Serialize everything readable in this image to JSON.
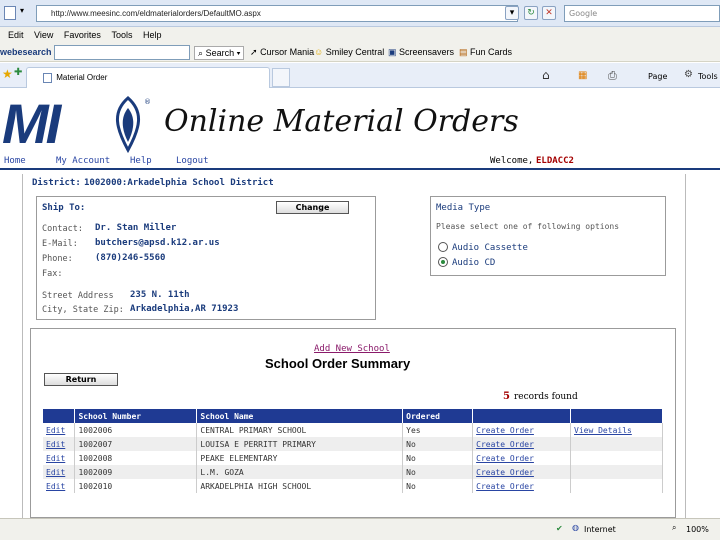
{
  "browser": {
    "url": "http://www.meesinc.com/eldmaterialorders/DefaultMO.aspx",
    "search_placeholder": "Google",
    "menu": [
      "Edit",
      "View",
      "Favorites",
      "Tools",
      "Help"
    ],
    "toolbar": {
      "brand": "webesearch",
      "search_label": "Search",
      "items": [
        "Cursor Mania",
        "Smiley Central",
        "Screensavers",
        "Fun Cards"
      ]
    },
    "tab_title": "Material Order",
    "tools_right": [
      "Page",
      "Tools"
    ],
    "status": {
      "zone": "Internet",
      "zoom": "100%"
    }
  },
  "header": {
    "logo": "MI",
    "title": "Online Material Orders",
    "nav": [
      "Home",
      "My Account",
      "Help",
      "Logout"
    ],
    "welcome_label": "Welcome,",
    "welcome_user": "ELDACC2"
  },
  "district": {
    "label": "District:",
    "value": "1002000:Arkadelphia School District"
  },
  "ship_to": {
    "title": "Ship To:",
    "change_button": "Change",
    "contact_label": "Contact:",
    "contact": "Dr. Stan Miller",
    "email_label": "E-Mail:",
    "email": "butchers@apsd.k12.ar.us",
    "phone_label": "Phone:",
    "phone": "(870)246-5560",
    "fax_label": "Fax:",
    "street_label": "Street Address",
    "street": "235 N. 11th",
    "city_label": "City, State Zip:",
    "city": "Arkadelphia,AR 71923"
  },
  "media": {
    "title": "Media Type",
    "instruction": "Please select one of following options",
    "options": [
      {
        "label": "Audio Cassette",
        "selected": false
      },
      {
        "label": "Audio CD",
        "selected": true
      }
    ]
  },
  "summary": {
    "add_link": "Add New School",
    "title": "School Order Summary",
    "return_button": "Return",
    "records_count": "5",
    "records_label": "records found",
    "columns": [
      "",
      "School Number",
      "School Name",
      "Ordered",
      "",
      ""
    ],
    "rows": [
      {
        "edit": "Edit",
        "number": "1002006",
        "name": "CENTRAL PRIMARY SCHOOL",
        "ordered": "Yes",
        "create": "Create Order",
        "details": "View Details"
      },
      {
        "edit": "Edit",
        "number": "1002007",
        "name": "LOUISA E PERRITT PRIMARY",
        "ordered": "No",
        "create": "Create Order",
        "details": ""
      },
      {
        "edit": "Edit",
        "number": "1002008",
        "name": "PEAKE ELEMENTARY",
        "ordered": "No",
        "create": "Create Order",
        "details": ""
      },
      {
        "edit": "Edit",
        "number": "1002009",
        "name": "L.M. GOZA",
        "ordered": "No",
        "create": "Create Order",
        "details": ""
      },
      {
        "edit": "Edit",
        "number": "1002010",
        "name": "ARKADELPHIA HIGH SCHOOL",
        "ordered": "No",
        "create": "Create Order",
        "details": ""
      }
    ]
  }
}
